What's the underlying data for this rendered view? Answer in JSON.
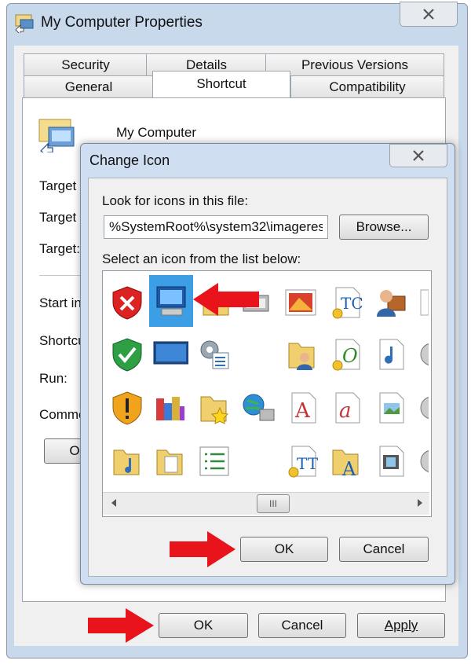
{
  "outer_window": {
    "title": "My Computer Properties",
    "tabs_row1": [
      "Security",
      "Details",
      "Previous Versions"
    ],
    "tabs_row2": [
      "General",
      "Shortcut",
      "Compatibility"
    ],
    "active_tab": "Shortcut",
    "shortcut_name": "My Computer",
    "field_labels": [
      "Target",
      "Target",
      "Target:",
      "Start in",
      "Shortcu",
      "Run:",
      "Comme"
    ],
    "open_button_label": "Op",
    "buttons": {
      "ok": "OK",
      "cancel": "Cancel",
      "apply": "Apply"
    }
  },
  "dialog": {
    "title": "Change Icon",
    "look_label": "Look for icons in this file:",
    "path_value": "%SystemRoot%\\system32\\imageres",
    "browse_label": "Browse...",
    "select_label": "Select an icon from the list below:",
    "scroll_thumb": "III",
    "buttons": {
      "ok": "OK",
      "cancel": "Cancel"
    }
  },
  "colors": {
    "annotation_arrow": "#e8131b",
    "selection": "#3c9fe6",
    "title_bar": "#c7d9ea"
  }
}
